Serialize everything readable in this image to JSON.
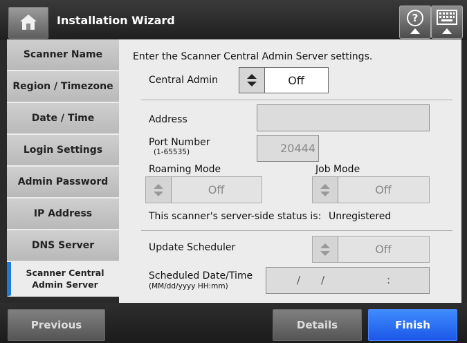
{
  "header": {
    "title": "Installation Wizard",
    "help_icon": "help-icon",
    "keyboard_icon": "keyboard-icon",
    "home_icon": "home-icon"
  },
  "sidebar": {
    "items": [
      {
        "label": "Scanner Name"
      },
      {
        "label": "Region / Timezone"
      },
      {
        "label": "Date / Time"
      },
      {
        "label": "Login Settings"
      },
      {
        "label": "Admin Password"
      },
      {
        "label": "IP Address"
      },
      {
        "label": "DNS Server"
      },
      {
        "label_line1": "Scanner Central",
        "label_line2": "Admin Server",
        "active": true
      }
    ]
  },
  "main": {
    "instruction": "Enter the Scanner Central Admin Server settings.",
    "central_admin": {
      "label": "Central Admin",
      "value": "Off"
    },
    "address": {
      "label": "Address",
      "value": ""
    },
    "port": {
      "label": "Port Number",
      "hint": "(1-65535)",
      "value": "20444"
    },
    "roaming_mode": {
      "label": "Roaming Mode",
      "value": "Off"
    },
    "job_mode": {
      "label": "Job Mode",
      "value": "Off"
    },
    "status": {
      "label": "This scanner's server-side status is:",
      "value": "Unregistered"
    },
    "update_scheduler": {
      "label": "Update Scheduler",
      "value": "Off"
    },
    "scheduled": {
      "label": "Scheduled Date/Time",
      "hint": "(MM/dd/yyyy HH:mm)",
      "sep1": "/",
      "sep2": "/",
      "sep3": ":"
    }
  },
  "footer": {
    "previous": "Previous",
    "details": "Details",
    "finish": "Finish"
  },
  "colors": {
    "accent": "#1e7bdc",
    "finish": "#2a6ef5"
  }
}
